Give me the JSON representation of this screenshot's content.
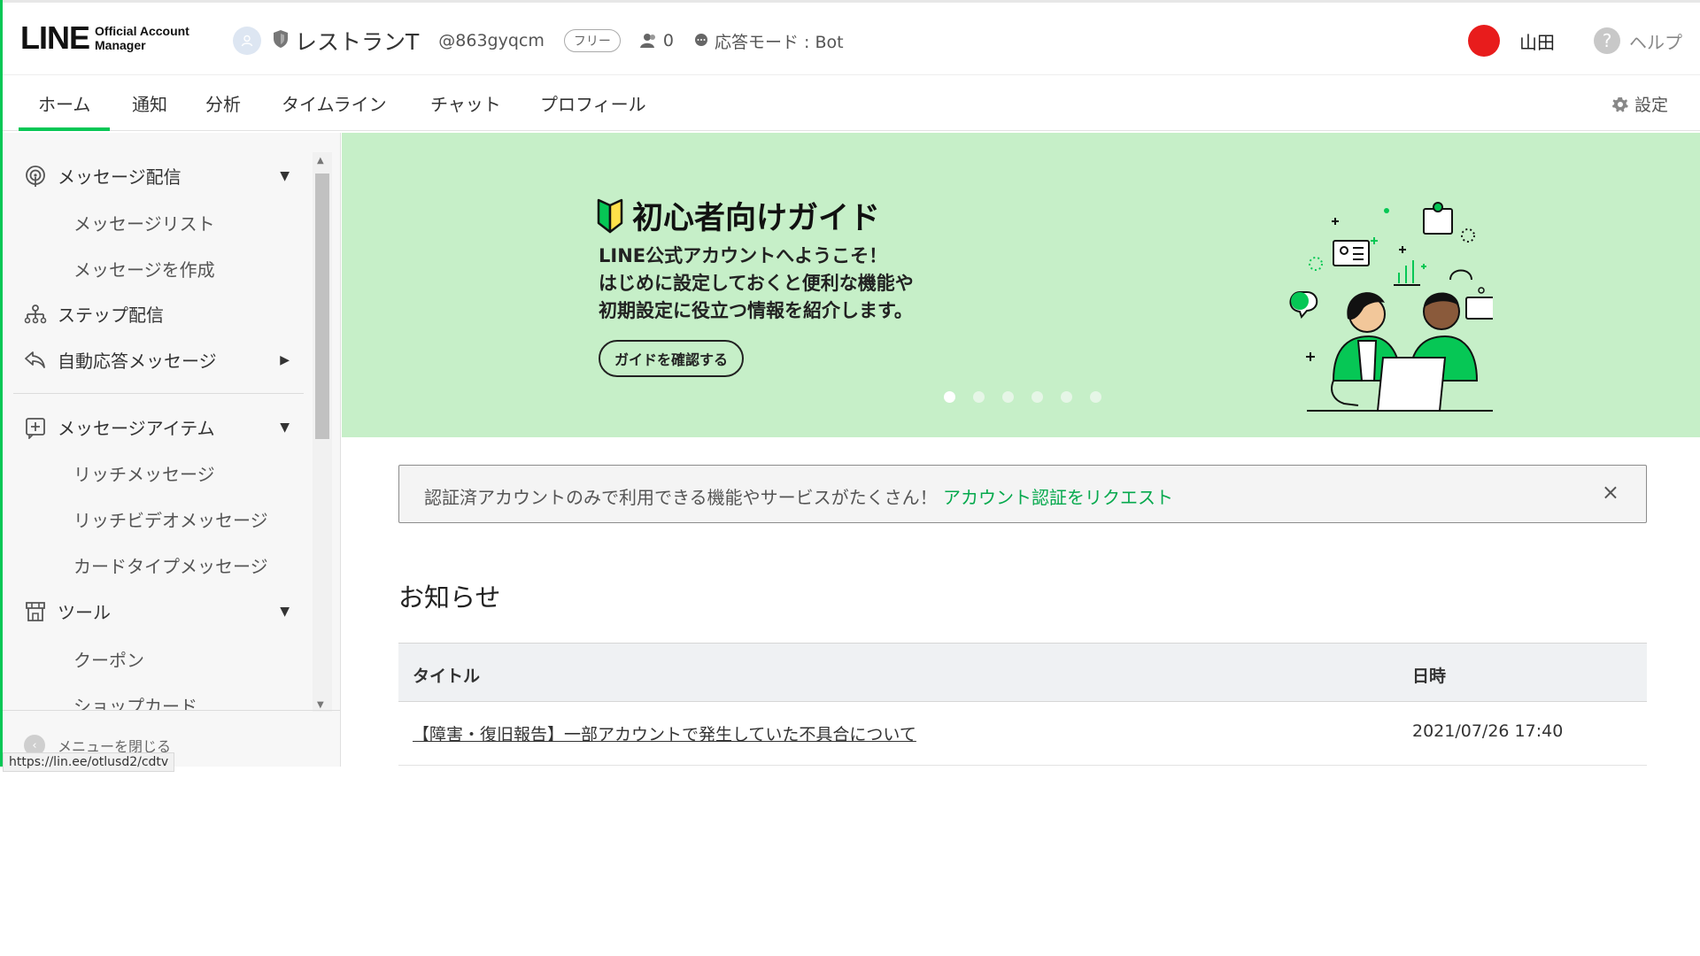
{
  "header": {
    "logo_main": "LINE",
    "logo_sub_1": "Official Account",
    "logo_sub_2": "Manager",
    "account_name": "レストランT",
    "account_id": "@863gyqcm",
    "plan": "フリー",
    "followers": "0",
    "mode": "応答モード : Bot",
    "user_name": "山田",
    "help": "ヘルプ"
  },
  "tabs": [
    "ホーム",
    "通知",
    "分析",
    "タイムライン",
    "チャット",
    "プロフィール"
  ],
  "settings_label": "設定",
  "sidebar": {
    "groups": {
      "message": "メッセージ配信",
      "message_list": "メッセージリスト",
      "message_create": "メッセージを作成",
      "step": "ステップ配信",
      "auto_reply": "自動応答メッセージ",
      "items": "メッセージアイテム",
      "rich": "リッチメッセージ",
      "rich_video": "リッチビデオメッセージ",
      "card": "カードタイプメッセージ",
      "tools": "ツール",
      "coupon": "クーポン",
      "shop_card": "ショップカード"
    },
    "close_menu": "メニューを閉じる",
    "url_tooltip": "https://lin.ee/otlusd2/cdtv"
  },
  "banner": {
    "title": "初心者向けガイド",
    "line1": "LINE公式アカウントへようこそ！",
    "line2": "はじめに設定しておくと便利な機能や",
    "line3": "初期設定に役立つ情報を紹介します。",
    "button": "ガイドを確認する",
    "slides": 6,
    "active_slide": 1
  },
  "notice": {
    "text": "認証済アカウントのみで利用できる機能やサービスがたくさん！",
    "link": "アカウント認証をリクエスト",
    "close": "×"
  },
  "news": {
    "title": "お知らせ",
    "columns": [
      "タイトル",
      "日時"
    ],
    "rows": [
      {
        "title": "【障害・復旧報告】一部アカウントで発生していた不具合について",
        "date": "2021/07/26 17:40"
      }
    ]
  },
  "colors": {
    "brand_green": "#06c755",
    "banner_bg": "#c6efc8",
    "link_green": "#06a94d",
    "user_avatar": "#e81c1c"
  }
}
